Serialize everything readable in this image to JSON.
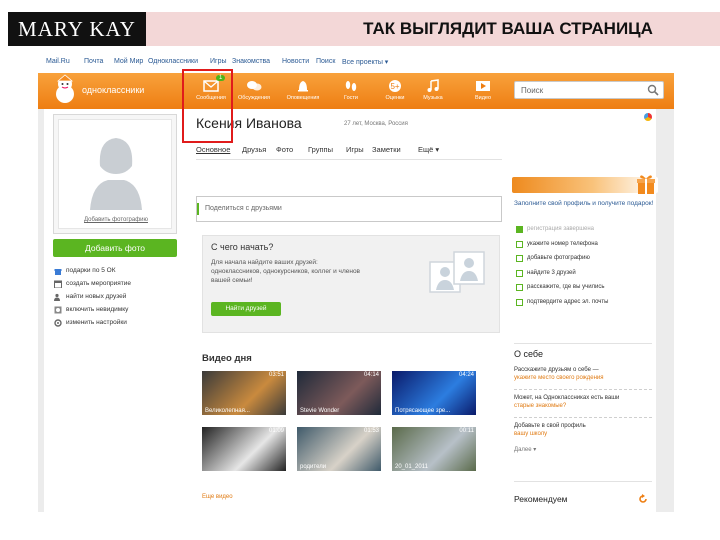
{
  "slide": {
    "brand": "MARY KAY",
    "title": "ТАК ВЫГЛЯДИТ ВАША СТРАНИЦА"
  },
  "topnav": [
    "Mail.Ru",
    "Почта",
    "Мой Мир",
    "Одноклассники",
    "Игры",
    "Знакомства",
    "Новости",
    "Поиск",
    "Все проекты ▾"
  ],
  "header": {
    "logo_text": "одноклассники",
    "nav": [
      {
        "label": "Сообщения",
        "icon": "envelope-icon",
        "badge": "1"
      },
      {
        "label": "Обсуждения",
        "icon": "chat-bubbles-icon"
      },
      {
        "label": "Оповещения",
        "icon": "bell-icon"
      },
      {
        "label": "Гости",
        "icon": "footprints-icon"
      },
      {
        "label": "Оценки",
        "icon": "rating-5plus-icon"
      },
      {
        "label": "Музыка",
        "icon": "music-note-icon"
      },
      {
        "label": "Видео",
        "icon": "video-film-icon"
      }
    ],
    "search_placeholder": "Поиск"
  },
  "left": {
    "avatar_caption": "Добавить фотографию",
    "add_photo_button": "Добавить фото",
    "menu": [
      {
        "label": "подарки по 5 ОК",
        "icon": "gift-icon"
      },
      {
        "label": "создать мероприятие",
        "icon": "calendar-icon"
      },
      {
        "label": "найти новых друзей",
        "icon": "people-icon"
      },
      {
        "label": "включить невидимку",
        "icon": "invisible-icon"
      },
      {
        "label": "изменить настройки",
        "icon": "settings-icon"
      }
    ]
  },
  "profile": {
    "name": "Ксения Иванова",
    "meta": "27 лет, Москва, Россия",
    "tabs": [
      "Основное",
      "Друзья",
      "Фото",
      "Группы",
      "Игры",
      "Заметки",
      "Ещё ▾"
    ]
  },
  "share_placeholder": "Поделиться с друзьями",
  "start": {
    "title": "С чего начать?",
    "description": "Для начала найдите ваших друзей: одноклассников, однокурсников, коллег и членов вашей семьи!",
    "button": "Найти друзей"
  },
  "video": {
    "title": "Видео дня",
    "items": [
      {
        "duration": "03:51",
        "caption": "Великолепная...",
        "color1": "#3a3a3a",
        "color2": "#c98a3e"
      },
      {
        "duration": "04:14",
        "caption": "Stevie Wonder",
        "color1": "#1f2a3a",
        "color2": "#7d5a5a"
      },
      {
        "duration": "04:24",
        "caption": "Потрясающее зре...",
        "color1": "#0a1a6a",
        "color2": "#2c7de0"
      },
      {
        "duration": "01:09",
        "caption": "",
        "color1": "#222222",
        "color2": "#e6e6e6"
      },
      {
        "duration": "01:53",
        "caption": "родители",
        "color1": "#3f5a6a",
        "color2": "#d8d2c8"
      },
      {
        "duration": "00:11",
        "caption": "20_01_2011",
        "color1": "#5a6a4a",
        "color2": "#b7c0c8"
      }
    ],
    "all_link": "Еще видео"
  },
  "right": {
    "promo": "Заполните свой профиль и получите подарок!",
    "checklist": [
      {
        "label": "регистрация завершена",
        "done": true
      },
      {
        "label": "укажите номер телефона",
        "done": false
      },
      {
        "label": "добавьте фотографию",
        "done": false
      },
      {
        "label": "найдите 3 друзей",
        "done": false
      },
      {
        "label": "расскажите, где вы учились",
        "done": false
      },
      {
        "label": "подтвердите адрес эл. почты",
        "done": false
      }
    ],
    "about_title": "О себе",
    "about_items": [
      {
        "text": "Расскажите друзьям о себе —",
        "link": "укажите место своего рождения"
      },
      {
        "text": "Может, на Одноклассниках есть ваши",
        "link": "старые знакомые?"
      },
      {
        "text": "Добавьте в свой профиль",
        "link": "вашу школу"
      }
    ],
    "more": "Далее ▾",
    "recommend_title": "Рекомендуем"
  },
  "colors": {
    "ok_orange": "#ee7e12",
    "green": "#5bb521",
    "highlight_red": "#e01b1b"
  }
}
